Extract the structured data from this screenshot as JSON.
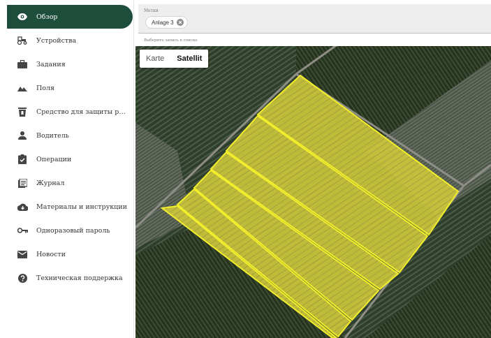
{
  "sidebar": {
    "items": [
      {
        "label": "Обзор",
        "icon": "eye-icon",
        "active": true
      },
      {
        "label": "Устройства",
        "icon": "tractor-icon"
      },
      {
        "label": "Задания",
        "icon": "briefcase-icon"
      },
      {
        "label": "Поля",
        "icon": "terrain-icon"
      },
      {
        "label": "Средство для защиты растен...",
        "icon": "trash-can-icon"
      },
      {
        "label": "Водитель",
        "icon": "person-icon"
      },
      {
        "label": "Операции",
        "icon": "clipboard-check-icon"
      },
      {
        "label": "Журнал",
        "icon": "journal-icon"
      },
      {
        "label": "Материалы и инструкции",
        "icon": "cloud-download-icon"
      },
      {
        "label": "Одноразовый пароль",
        "icon": "key-icon"
      },
      {
        "label": "Новости",
        "icon": "mail-icon"
      },
      {
        "label": "Техническая поддержка",
        "icon": "help-icon"
      }
    ]
  },
  "filter": {
    "label": "Метки",
    "chip": "Anlage 3",
    "hint": "Выберите запись в списке"
  },
  "map": {
    "tabs": [
      {
        "label": "Karte",
        "active": false
      },
      {
        "label": "Satellit",
        "active": true
      }
    ]
  },
  "colors": {
    "accent": "#1d4d3b",
    "field_fill": "#d8d33a",
    "field_stroke": "#f2ee2c"
  }
}
